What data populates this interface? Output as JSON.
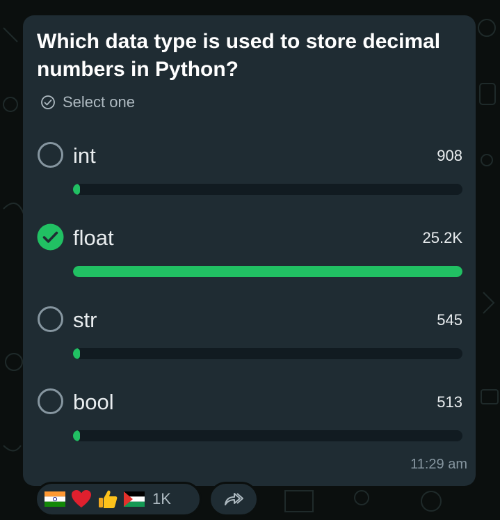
{
  "poll": {
    "question": "Which data type is used to store decimal numbers in Python?",
    "instruction": "Select one",
    "options": [
      {
        "label": "int",
        "count": "908",
        "fraction": 0.016,
        "selected": false
      },
      {
        "label": "float",
        "count": "25.2K",
        "fraction": 1.0,
        "selected": true
      },
      {
        "label": "str",
        "count": "545",
        "fraction": 0.01,
        "selected": false
      },
      {
        "label": "bool",
        "count": "513",
        "fraction": 0.01,
        "selected": false
      }
    ],
    "timestamp": "11:29 am"
  },
  "reactions": {
    "emojis": [
      "india-flag-icon",
      "red-heart-icon",
      "thumbs-up-icon",
      "palestine-flag-icon"
    ],
    "count": "1K"
  },
  "colors": {
    "bubble": "#1f2c33",
    "accent_green": "#21c063",
    "track": "#111b21",
    "background": "#0b0f0e"
  }
}
